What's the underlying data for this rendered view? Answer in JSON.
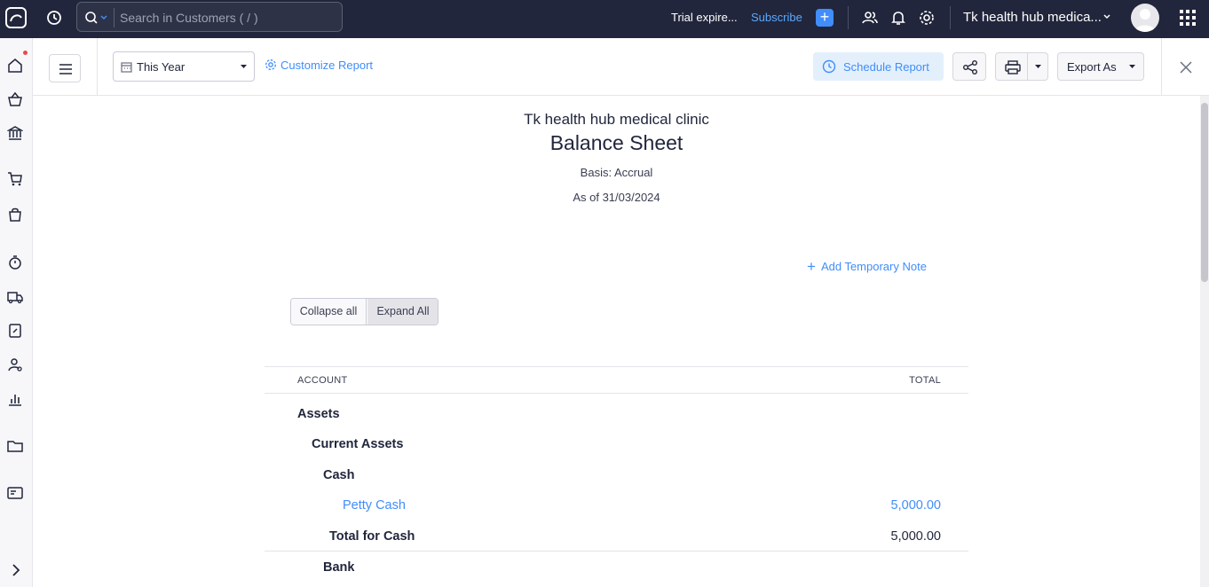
{
  "topbar": {
    "search_placeholder": "Search in Customers ( / )",
    "trial_text": "Trial expire...",
    "subscribe_label": "Subscribe",
    "org_name": "Tk health hub medica...",
    "accent_color": "#408dfb"
  },
  "toolbar": {
    "date_range": "This Year",
    "customize_label": "Customize Report",
    "schedule_label": "Schedule Report",
    "export_label": "Export As"
  },
  "report": {
    "organization": "Tk health hub medical clinic",
    "title": "Balance Sheet",
    "basis": "Basis: Accrual",
    "as_of": "As of 31/03/2024",
    "add_note_label": "Add Temporary Note",
    "collapse_label": "Collapse all",
    "expand_label": "Expand All",
    "columns": {
      "account": "ACCOUNT",
      "total": "TOTAL"
    },
    "rows": [
      {
        "label": "Assets",
        "value": "",
        "style": "bold"
      },
      {
        "label": "Current Assets",
        "value": "",
        "style": "bold"
      },
      {
        "label": "Cash",
        "value": "",
        "style": "bold"
      },
      {
        "label": "Petty Cash",
        "value": "5,000.00",
        "style": "link"
      },
      {
        "label": "Total for Cash",
        "value": "5,000.00",
        "style": "total"
      },
      {
        "label": "Bank",
        "value": "",
        "style": "bold"
      }
    ]
  }
}
